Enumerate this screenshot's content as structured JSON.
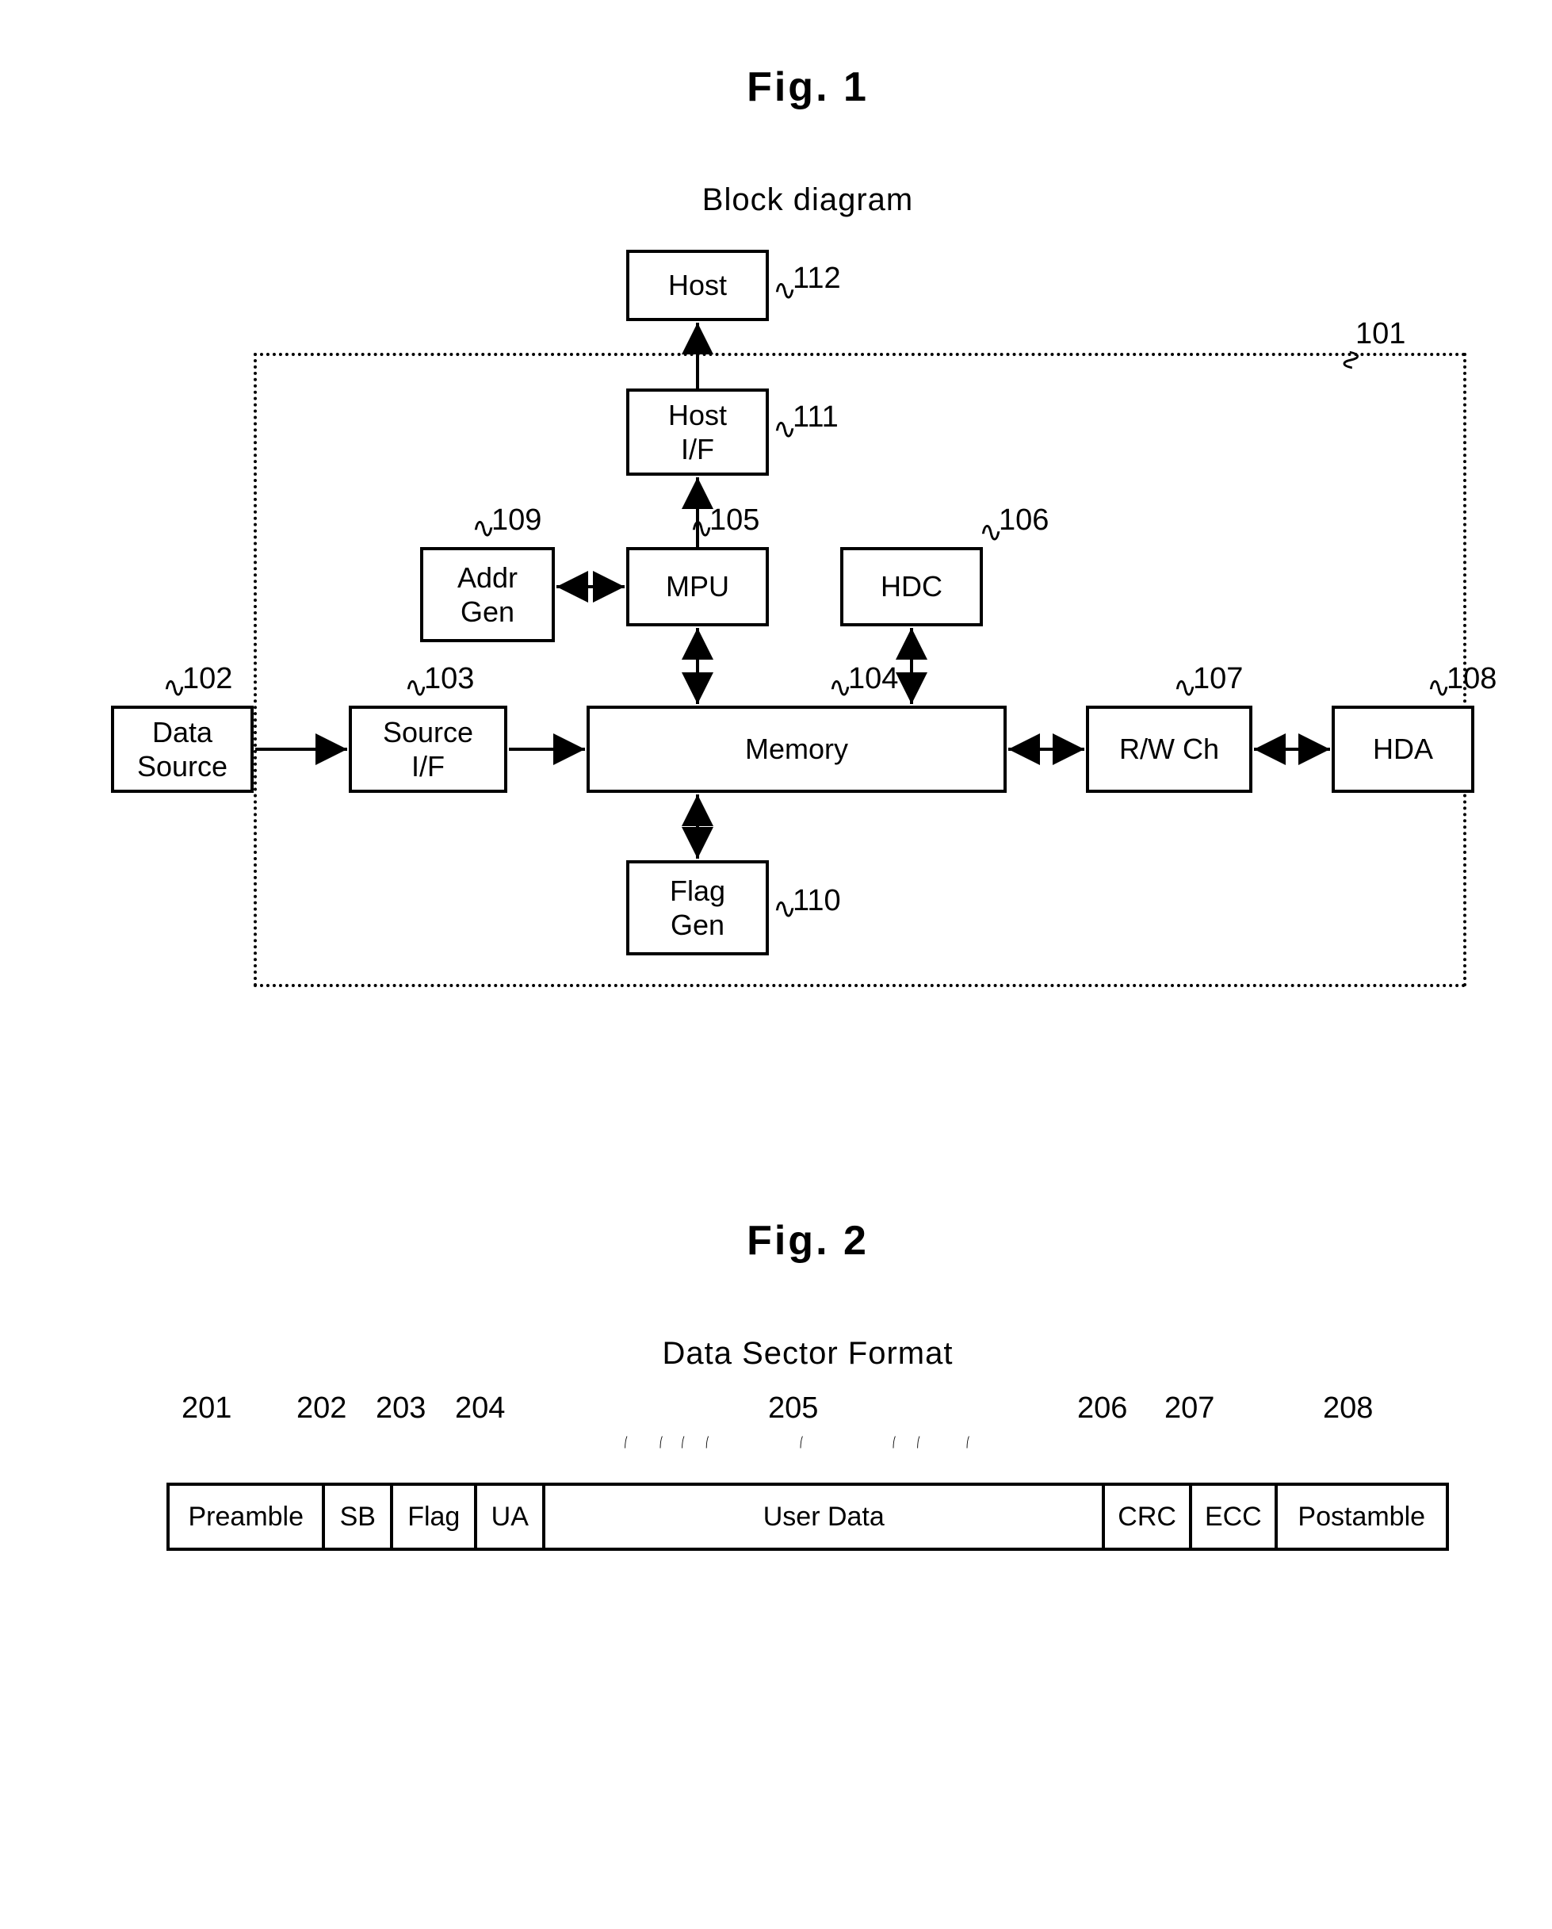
{
  "fig1": {
    "title": "Fig. 1",
    "subtitle": "Block diagram",
    "blocks": {
      "host": "Host",
      "hostif": "Host\nI/F",
      "mpu": "MPU",
      "hdc": "HDC",
      "addrgen": "Addr\nGen",
      "memory": "Memory",
      "datasource": "Data\nSource",
      "sourceif": "Source\nI/F",
      "rwch": "R/W Ch",
      "hda": "HDA",
      "flaggen": "Flag\nGen"
    },
    "refs": {
      "host": "112",
      "hostif": "111",
      "mpu": "105",
      "hdc": "106",
      "addrgen": "109",
      "memory": "104",
      "datasource": "102",
      "sourceif": "103",
      "rwch": "107",
      "hda": "108",
      "flaggen": "110",
      "boundary": "101"
    }
  },
  "fig2": {
    "title": "Fig. 2",
    "subtitle": "Data Sector Format",
    "fields": {
      "preamble": "Preamble",
      "sb": "SB",
      "flag": "Flag",
      "ua": "UA",
      "userdata": "User Data",
      "crc": "CRC",
      "ecc": "ECC",
      "postamble": "Postamble"
    },
    "refs": {
      "preamble": "201",
      "sb": "202",
      "flag": "203",
      "ua": "204",
      "userdata": "205",
      "crc": "206",
      "ecc": "207",
      "postamble": "208"
    }
  }
}
